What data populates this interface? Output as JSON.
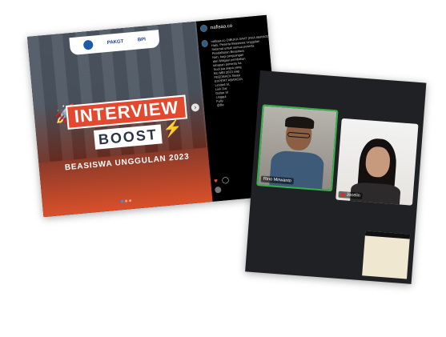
{
  "instagram_post": {
    "account": "nafisaa.co",
    "logos": [
      "PAKGT",
      "BPI"
    ],
    "title_line1": "INTERVIEW",
    "title_line2": "BOOST",
    "subtitle": "BEASISWA UNGGULAN 2023",
    "caption_lines": [
      "nafisaa.co DIBUKA SAAT (AKA ABANGDI",
      "Halo, Peserta Beasiswa Unggulan",
      "Selamat untuk semua peserta",
      "Pendaftaran Beasiswa",
      "Nah, bagi penjuangan",
      "dari Mitigasi pembelian",
      "tahapan penentu ka",
      "Sudi jua siapa yang",
      "BU MBI 2023 siap",
      "FEEDBACK Beasi",
      "EXPERT ABANGDI",
      "Limited SL",
      "Link Dar",
      "Daftar Sl",
      "Unggul",
      "Fully",
      "@Be"
    ],
    "icons": [
      "rocket-icon",
      "lightning-icon",
      "heart-icon",
      "comment-icon",
      "chevron-right-icon"
    ],
    "accent_color": "#e2492f"
  },
  "video_call": {
    "participants": [
      {
        "name": "Rino Mirwanto",
        "mic_muted": false
      },
      {
        "name": "Jocelin",
        "mic_muted": true
      }
    ],
    "active_speaker_color": "#35b04a"
  }
}
